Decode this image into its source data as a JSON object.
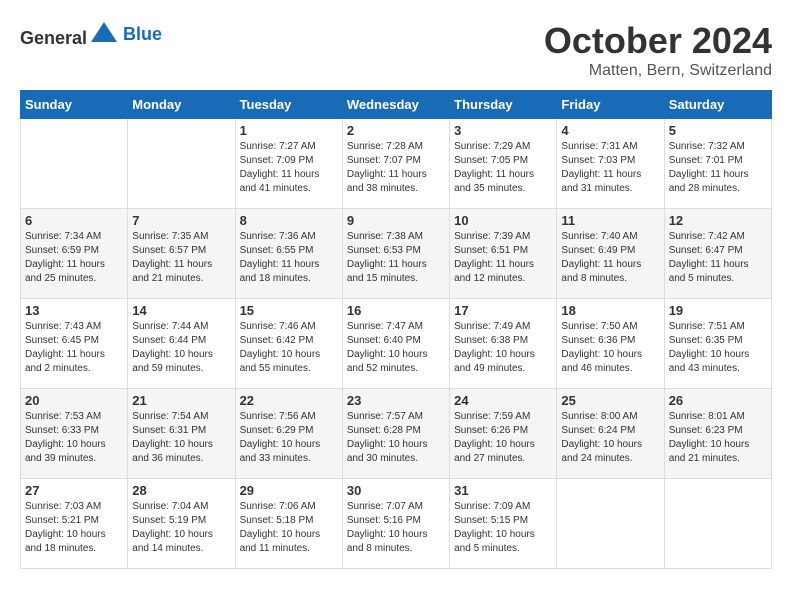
{
  "header": {
    "logo_general": "General",
    "logo_blue": "Blue",
    "title": "October 2024",
    "location": "Matten, Bern, Switzerland"
  },
  "days_of_week": [
    "Sunday",
    "Monday",
    "Tuesday",
    "Wednesday",
    "Thursday",
    "Friday",
    "Saturday"
  ],
  "weeks": [
    [
      {
        "day": "",
        "sunrise": "",
        "sunset": "",
        "daylight": ""
      },
      {
        "day": "",
        "sunrise": "",
        "sunset": "",
        "daylight": ""
      },
      {
        "day": "1",
        "sunrise": "Sunrise: 7:27 AM",
        "sunset": "Sunset: 7:09 PM",
        "daylight": "Daylight: 11 hours and 41 minutes."
      },
      {
        "day": "2",
        "sunrise": "Sunrise: 7:28 AM",
        "sunset": "Sunset: 7:07 PM",
        "daylight": "Daylight: 11 hours and 38 minutes."
      },
      {
        "day": "3",
        "sunrise": "Sunrise: 7:29 AM",
        "sunset": "Sunset: 7:05 PM",
        "daylight": "Daylight: 11 hours and 35 minutes."
      },
      {
        "day": "4",
        "sunrise": "Sunrise: 7:31 AM",
        "sunset": "Sunset: 7:03 PM",
        "daylight": "Daylight: 11 hours and 31 minutes."
      },
      {
        "day": "5",
        "sunrise": "Sunrise: 7:32 AM",
        "sunset": "Sunset: 7:01 PM",
        "daylight": "Daylight: 11 hours and 28 minutes."
      }
    ],
    [
      {
        "day": "6",
        "sunrise": "Sunrise: 7:34 AM",
        "sunset": "Sunset: 6:59 PM",
        "daylight": "Daylight: 11 hours and 25 minutes."
      },
      {
        "day": "7",
        "sunrise": "Sunrise: 7:35 AM",
        "sunset": "Sunset: 6:57 PM",
        "daylight": "Daylight: 11 hours and 21 minutes."
      },
      {
        "day": "8",
        "sunrise": "Sunrise: 7:36 AM",
        "sunset": "Sunset: 6:55 PM",
        "daylight": "Daylight: 11 hours and 18 minutes."
      },
      {
        "day": "9",
        "sunrise": "Sunrise: 7:38 AM",
        "sunset": "Sunset: 6:53 PM",
        "daylight": "Daylight: 11 hours and 15 minutes."
      },
      {
        "day": "10",
        "sunrise": "Sunrise: 7:39 AM",
        "sunset": "Sunset: 6:51 PM",
        "daylight": "Daylight: 11 hours and 12 minutes."
      },
      {
        "day": "11",
        "sunrise": "Sunrise: 7:40 AM",
        "sunset": "Sunset: 6:49 PM",
        "daylight": "Daylight: 11 hours and 8 minutes."
      },
      {
        "day": "12",
        "sunrise": "Sunrise: 7:42 AM",
        "sunset": "Sunset: 6:47 PM",
        "daylight": "Daylight: 11 hours and 5 minutes."
      }
    ],
    [
      {
        "day": "13",
        "sunrise": "Sunrise: 7:43 AM",
        "sunset": "Sunset: 6:45 PM",
        "daylight": "Daylight: 11 hours and 2 minutes."
      },
      {
        "day": "14",
        "sunrise": "Sunrise: 7:44 AM",
        "sunset": "Sunset: 6:44 PM",
        "daylight": "Daylight: 10 hours and 59 minutes."
      },
      {
        "day": "15",
        "sunrise": "Sunrise: 7:46 AM",
        "sunset": "Sunset: 6:42 PM",
        "daylight": "Daylight: 10 hours and 55 minutes."
      },
      {
        "day": "16",
        "sunrise": "Sunrise: 7:47 AM",
        "sunset": "Sunset: 6:40 PM",
        "daylight": "Daylight: 10 hours and 52 minutes."
      },
      {
        "day": "17",
        "sunrise": "Sunrise: 7:49 AM",
        "sunset": "Sunset: 6:38 PM",
        "daylight": "Daylight: 10 hours and 49 minutes."
      },
      {
        "day": "18",
        "sunrise": "Sunrise: 7:50 AM",
        "sunset": "Sunset: 6:36 PM",
        "daylight": "Daylight: 10 hours and 46 minutes."
      },
      {
        "day": "19",
        "sunrise": "Sunrise: 7:51 AM",
        "sunset": "Sunset: 6:35 PM",
        "daylight": "Daylight: 10 hours and 43 minutes."
      }
    ],
    [
      {
        "day": "20",
        "sunrise": "Sunrise: 7:53 AM",
        "sunset": "Sunset: 6:33 PM",
        "daylight": "Daylight: 10 hours and 39 minutes."
      },
      {
        "day": "21",
        "sunrise": "Sunrise: 7:54 AM",
        "sunset": "Sunset: 6:31 PM",
        "daylight": "Daylight: 10 hours and 36 minutes."
      },
      {
        "day": "22",
        "sunrise": "Sunrise: 7:56 AM",
        "sunset": "Sunset: 6:29 PM",
        "daylight": "Daylight: 10 hours and 33 minutes."
      },
      {
        "day": "23",
        "sunrise": "Sunrise: 7:57 AM",
        "sunset": "Sunset: 6:28 PM",
        "daylight": "Daylight: 10 hours and 30 minutes."
      },
      {
        "day": "24",
        "sunrise": "Sunrise: 7:59 AM",
        "sunset": "Sunset: 6:26 PM",
        "daylight": "Daylight: 10 hours and 27 minutes."
      },
      {
        "day": "25",
        "sunrise": "Sunrise: 8:00 AM",
        "sunset": "Sunset: 6:24 PM",
        "daylight": "Daylight: 10 hours and 24 minutes."
      },
      {
        "day": "26",
        "sunrise": "Sunrise: 8:01 AM",
        "sunset": "Sunset: 6:23 PM",
        "daylight": "Daylight: 10 hours and 21 minutes."
      }
    ],
    [
      {
        "day": "27",
        "sunrise": "Sunrise: 7:03 AM",
        "sunset": "Sunset: 5:21 PM",
        "daylight": "Daylight: 10 hours and 18 minutes."
      },
      {
        "day": "28",
        "sunrise": "Sunrise: 7:04 AM",
        "sunset": "Sunset: 5:19 PM",
        "daylight": "Daylight: 10 hours and 14 minutes."
      },
      {
        "day": "29",
        "sunrise": "Sunrise: 7:06 AM",
        "sunset": "Sunset: 5:18 PM",
        "daylight": "Daylight: 10 hours and 11 minutes."
      },
      {
        "day": "30",
        "sunrise": "Sunrise: 7:07 AM",
        "sunset": "Sunset: 5:16 PM",
        "daylight": "Daylight: 10 hours and 8 minutes."
      },
      {
        "day": "31",
        "sunrise": "Sunrise: 7:09 AM",
        "sunset": "Sunset: 5:15 PM",
        "daylight": "Daylight: 10 hours and 5 minutes."
      },
      {
        "day": "",
        "sunrise": "",
        "sunset": "",
        "daylight": ""
      },
      {
        "day": "",
        "sunrise": "",
        "sunset": "",
        "daylight": ""
      }
    ]
  ]
}
